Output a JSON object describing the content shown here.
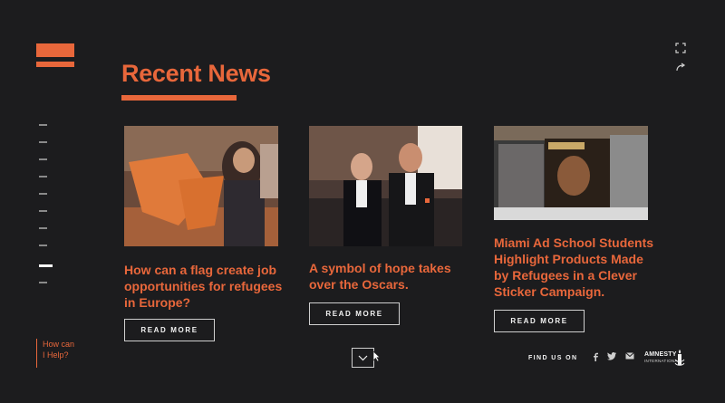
{
  "header": {
    "title": "Recent News"
  },
  "help": {
    "label_line1": "How can",
    "label_line2": "I Help?"
  },
  "side_nav": {
    "items": 10,
    "active_index": 8
  },
  "cards": [
    {
      "title_lines": [
        "How can a flag create job",
        "opportunities for refugees",
        "in Europe?"
      ],
      "button": "READ MORE"
    },
    {
      "title_lines": [
        "A symbol of hope takes",
        "over the Oscars."
      ],
      "button": "READ MORE"
    },
    {
      "title_lines": [
        "Miami Ad School Students",
        "Highlight Products Made",
        "by Refugees in a Clever",
        "Sticker Campaign."
      ],
      "button": "READ MORE"
    }
  ],
  "footer": {
    "find_us": "FIND US ON",
    "social_icons": [
      "facebook-icon",
      "twitter-icon",
      "mail-icon"
    ],
    "logo_line1": "AMNESTY",
    "logo_line2": "INTERNATIONAL"
  },
  "colors": {
    "accent": "#e8673b",
    "background": "#1c1c1e",
    "text_light": "#f2f2f2"
  }
}
